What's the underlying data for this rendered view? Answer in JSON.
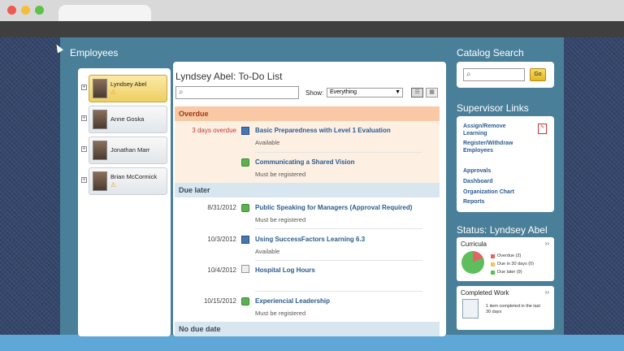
{
  "sections": {
    "employees": "Employees",
    "catalog_search": "Catalog Search",
    "supervisor_links": "Supervisor Links",
    "status": "Status: Lyndsey Abel"
  },
  "employees": [
    {
      "name": "Lyndsey Abel",
      "warning": true,
      "selected": true
    },
    {
      "name": "Anne Goska",
      "warning": false,
      "selected": false
    },
    {
      "name": "Jonathan Marr",
      "warning": false,
      "selected": false
    },
    {
      "name": "Brian McCormick",
      "warning": true,
      "selected": false
    }
  ],
  "todo": {
    "title": "Lyndsey Abel: To-Do List",
    "search_placeholder": "",
    "show_label": "Show:",
    "show_value": "Everything",
    "groups": {
      "overdue": "Overdue",
      "due_later": "Due later",
      "no_due_date": "No due date"
    },
    "items": [
      {
        "date": "3 days overdue",
        "icon": "monitor-icon",
        "title": "Basic Preparedness with Level 1 Evaluation",
        "sub": "Available"
      },
      {
        "date": "",
        "icon": "person-icon",
        "title": "Communicating a Shared Vision",
        "sub": "Must be registered"
      },
      {
        "date": "8/31/2012",
        "icon": "person-icon",
        "title": "Public Speaking for Managers (Approval Required)",
        "sub": "Must be registered"
      },
      {
        "date": "10/3/2012",
        "icon": "monitor-icon",
        "title": "Using SuccessFactors Learning 6.3",
        "sub": "Available"
      },
      {
        "date": "10/4/2012",
        "icon": "document-icon",
        "title": "Hospital Log Hours",
        "sub": ""
      },
      {
        "date": "10/15/2012",
        "icon": "person-icon",
        "title": "Experiencial Leadership",
        "sub": "Must be registered"
      }
    ]
  },
  "catalog": {
    "go_label": "Go"
  },
  "supervisor": {
    "links": [
      "Assign/Remove Learning",
      "Register/Withdraw Employees",
      "Approvals",
      "Dashboard",
      "Organization Chart",
      "Reports"
    ]
  },
  "status": {
    "curricula": {
      "title": "Curricula",
      "more": "››",
      "legend": [
        {
          "label": "Overdue (2)",
          "color": "#e06666"
        },
        {
          "label": "Due in 30 days (0)",
          "color": "#f1c35a"
        },
        {
          "label": "Due later (9)",
          "color": "#5cbf5c"
        }
      ]
    },
    "completed": {
      "title": "Completed Work",
      "more": "››",
      "text": "1 item completed in the last 30 days"
    }
  },
  "colors": {
    "accent": "#2b5a8f",
    "overdue": "#a03a18",
    "panel": "#4a7f99"
  }
}
